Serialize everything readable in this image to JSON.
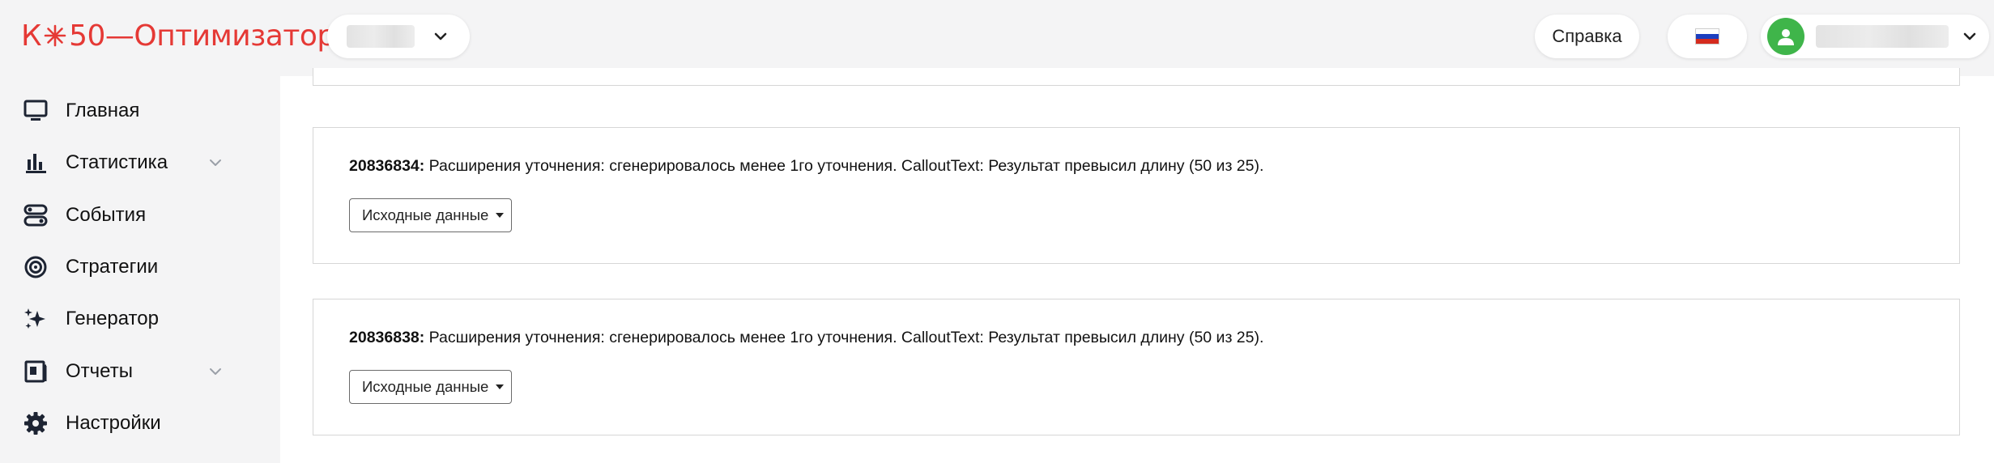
{
  "header": {
    "logo_left": "К",
    "logo_right": "50—Оптимизатор",
    "help_label": "Справка",
    "brand_color": "#e53935",
    "avatar_color": "#3fb54a"
  },
  "sidebar": {
    "items": [
      {
        "label": "Главная",
        "icon": "monitor-icon",
        "expandable": false
      },
      {
        "label": "Статистика",
        "icon": "bar-chart-icon",
        "expandable": true
      },
      {
        "label": "События",
        "icon": "toggles-icon",
        "expandable": false
      },
      {
        "label": "Стратегии",
        "icon": "target-icon",
        "expandable": false
      },
      {
        "label": "Генератор",
        "icon": "sparkles-icon",
        "expandable": false
      },
      {
        "label": "Отчеты",
        "icon": "report-icon",
        "expandable": true
      },
      {
        "label": "Настройки",
        "icon": "gear-icon",
        "expandable": false
      }
    ]
  },
  "main": {
    "cards": [
      {
        "id": "20836834:",
        "message": " Расширения уточнения: сгенерировалось менее 1го уточнения. CalloutText: Результат превысил длину (50 из 25).",
        "button_label": "Исходные данные"
      },
      {
        "id": "20836838:",
        "message": " Расширения уточнения: сгенерировалось менее 1го уточнения. CalloutText: Результат превысил длину (50 из 25).",
        "button_label": "Исходные данные"
      }
    ]
  }
}
